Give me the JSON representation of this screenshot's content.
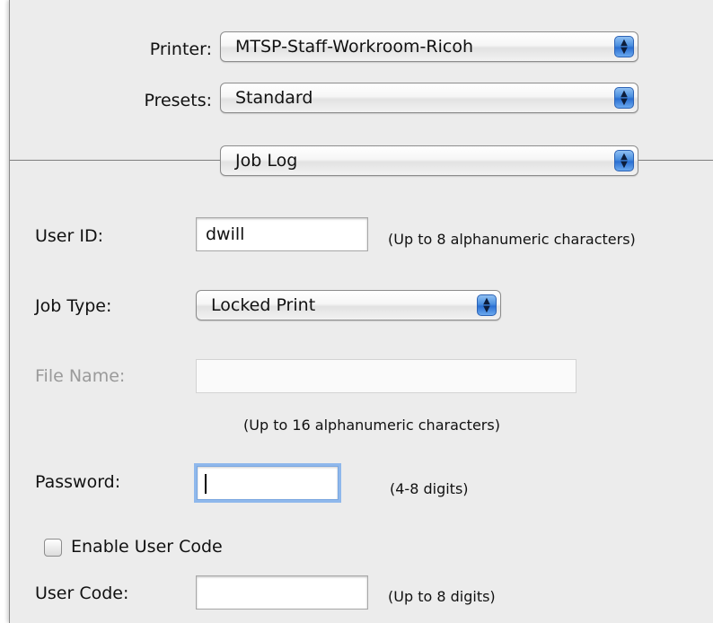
{
  "printer": {
    "label": "Printer:",
    "value": "MTSP-Staff-Workroom-Ricoh"
  },
  "presets": {
    "label": "Presets:",
    "value": "Standard"
  },
  "pane": {
    "value": "Job Log"
  },
  "user_id": {
    "label": "User ID:",
    "value": "dwill",
    "hint": "(Up to 8 alphanumeric characters)"
  },
  "job_type": {
    "label": "Job Type:",
    "value": "Locked Print"
  },
  "file_name": {
    "label": "File Name:",
    "value": "",
    "hint": "(Up to 16 alphanumeric characters)"
  },
  "password": {
    "label": "Password:",
    "value": "",
    "hint": "(4-8 digits)"
  },
  "enable_user_code": {
    "label": "Enable User Code",
    "checked": false
  },
  "user_code": {
    "label": "User Code:",
    "value": "",
    "hint": "(Up to 8 digits)"
  },
  "icons": {
    "popup_arrows": "up-down-arrows-icon",
    "checkbox": "checkbox-unchecked-icon"
  },
  "colors": {
    "panel_bg": "#ececec",
    "popup_arrow_blue": "#4a8fe0",
    "focus_ring": "#8fb8ec"
  }
}
